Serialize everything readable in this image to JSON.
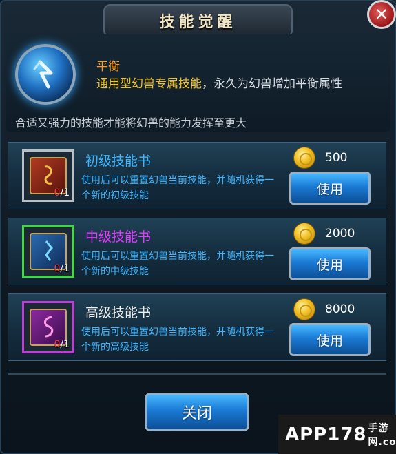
{
  "window": {
    "title": "技能觉醒",
    "close_icon": "✕"
  },
  "skill": {
    "name": "平衡",
    "desc_highlight": "通用型幻兽专属技能",
    "desc_rest": "，永久为幻兽增加平衡属性",
    "hint": "合适又强力的技能才能将幻兽的能力发挥至更大",
    "icon": "balance-rune-icon"
  },
  "books": [
    {
      "title": "初级技能书",
      "title_color": "#3db6ff",
      "frame": "gray",
      "cover_color": "#8b2a1e",
      "owned": "0",
      "needed": "/1",
      "desc": "使用后可以重置幻兽当前技能，并随机获得一个新的初级技能",
      "price": "500",
      "button": "使用"
    },
    {
      "title": "中级技能书",
      "title_color": "#e23bff",
      "frame": "green",
      "cover_color": "#1e4f8b",
      "owned": "0",
      "needed": "/1",
      "desc": "使用后可以重置幻兽当前技能，并随机获得一个新的中级技能",
      "price": "2000",
      "button": "使用"
    },
    {
      "title": "高级技能书",
      "title_color": "#f0f0f0",
      "frame": "purple",
      "cover_color": "#6b1e7a",
      "owned": "0",
      "needed": "/1",
      "desc": "使用后可以重置幻兽当前技能，并随机获得一个新的高级技能",
      "price": "8000",
      "button": "使用"
    }
  ],
  "footer": {
    "close_label": "关闭"
  },
  "watermark": {
    "text": "APP178",
    "sub": "手游网.com"
  }
}
